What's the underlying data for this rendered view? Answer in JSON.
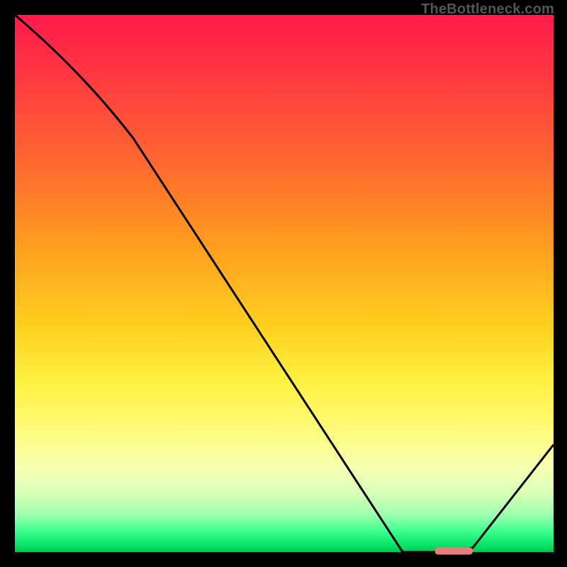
{
  "watermark": "TheBottleneck.com",
  "chart_data": {
    "type": "line",
    "title": "",
    "xlabel": "",
    "ylabel": "",
    "xlim": [
      0,
      100
    ],
    "ylim": [
      0,
      100
    ],
    "series": [
      {
        "name": "curve",
        "x": [
          0,
          22,
          72,
          78,
          85,
          100
        ],
        "y": [
          100,
          77,
          0,
          0,
          0.8,
          20
        ]
      }
    ],
    "marker": {
      "x_start": 78,
      "x_end": 85,
      "y": 0.2,
      "color": "#ed7b7b"
    },
    "background_gradient_vertical": [
      {
        "pct": 0,
        "color": "#ff1a4a"
      },
      {
        "pct": 28,
        "color": "#ff6a30"
      },
      {
        "pct": 58,
        "color": "#ffd020"
      },
      {
        "pct": 76,
        "color": "#fffa70"
      },
      {
        "pct": 93,
        "color": "#a0ffb0"
      },
      {
        "pct": 100,
        "color": "#00c050"
      }
    ]
  }
}
